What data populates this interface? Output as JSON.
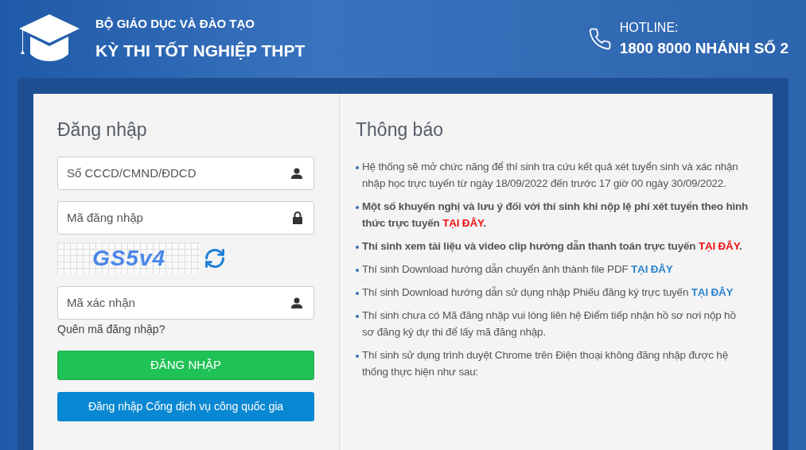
{
  "header": {
    "org": "BỘ GIÁO DỤC VÀ ĐÀO TẠO",
    "title": "KỲ THI TỐT NGHIỆP THPT",
    "hotline_label": "HOTLINE:",
    "hotline_number": "1800 8000 NHÁNH SỐ 2"
  },
  "login": {
    "heading": "Đăng nhập",
    "fields": [
      {
        "placeholder": "Số CCCD/CMND/ĐDCD",
        "kind": "user"
      },
      {
        "placeholder": "Mã đăng nhập",
        "kind": "lock"
      },
      {
        "placeholder": "Mã xác nhận",
        "kind": "user",
        "captcha": "GS5v4"
      }
    ],
    "forgot": "Quên mã đăng nhập?",
    "submit": "ĐĂNG NHẬP",
    "national_portal": "Đăng nhập Cổng dịch vụ công quốc gia"
  },
  "notices": {
    "heading": "Thông báo",
    "items": [
      {
        "text": "Hệ thống sẽ mở chức năng để thí sinh tra cứu kết quả xét tuyển sinh và xác nhận nhập học trực tuyến từ ngày 18/09/2022 đến trước 17 giờ 00 ngày 30/09/2022.",
        "bold": false
      },
      {
        "text": "Một số khuyến nghị và lưu ý đối với thí sinh khi nộp lệ phí xét tuyển theo hình thức trực tuyến",
        "bold": true,
        "link": {
          "label": "TẠI ĐÂY",
          "color": "#ee1111"
        },
        "after": "."
      },
      {
        "text": "Thí sinh xem tài liệu và video clip hướng dẫn thanh toán trực tuyến",
        "bold": true,
        "link": {
          "label": "TẠI ĐÂY",
          "color": "#ee1111"
        },
        "after": "."
      },
      {
        "text": "Thí sinh Download hướng dẫn chuyển ảnh thành file PDF",
        "bold": false,
        "link": {
          "label": "TẠI ĐÂY",
          "color": "#2a83d0"
        }
      },
      {
        "text": "Thí sinh Download hướng dẫn sử dụng nhập Phiếu đăng ký trực tuyến",
        "bold": false,
        "link": {
          "label": "TẠI ĐÂY",
          "color": "#2a83d0"
        }
      },
      {
        "text": "Thí sinh chưa có Mã đăng nhập vui lòng liên hệ Điểm tiếp nhận hồ sơ nơi nộp hồ sơ đăng ký dự thi để lấy mã đăng nhập.",
        "bold": false
      },
      {
        "text": "Thí sinh sử dụng trình duyệt Chrome trên Điện thoại không đăng nhập được hệ thống thực hiện như sau:",
        "bold": false
      }
    ]
  }
}
